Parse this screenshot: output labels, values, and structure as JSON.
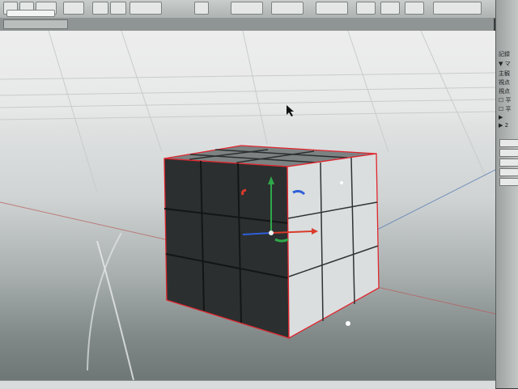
{
  "toolbar": {
    "buttons": [
      {
        "icon": "tool-icon-1"
      },
      {
        "icon": "tool-icon-2"
      },
      {
        "icon": "tool-icon-3"
      },
      {
        "icon": "tool-icon-4"
      },
      {
        "icon": "tool-icon-5"
      }
    ],
    "dropdown_value": ""
  },
  "viewport": {
    "tab_label": "",
    "cursor": "arrow-cursor",
    "object": "cube-3x3",
    "gizmo_colors": {
      "x": "#d93b2b",
      "y": "#2fa84a",
      "z": "#2f5fd9"
    },
    "selection_color": "#e0262f"
  },
  "right_panel": {
    "items": [
      "記録",
      "▼ マ",
      "主観",
      "視点",
      "視点",
      "☐ 平",
      "☐ 平",
      "▶",
      "▶ 2"
    ]
  }
}
